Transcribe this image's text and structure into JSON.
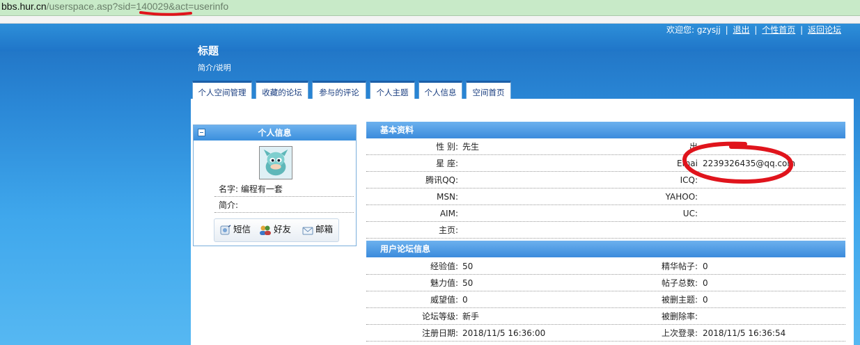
{
  "address_bar": {
    "host": "bbs.hur.cn",
    "path": "/userspace.asp?sid=140029&act=userinfo"
  },
  "top_links": {
    "welcome": "欢迎您: gzysjj",
    "logout": "退出",
    "personal_home": "个性首页",
    "back_forum": "返回论坛",
    "separator": "|"
  },
  "header": {
    "title": "标题",
    "subtitle": "简介/说明"
  },
  "tabs": [
    {
      "label": "个人空间管理"
    },
    {
      "label": "收藏的论坛"
    },
    {
      "label": "参与的评论"
    },
    {
      "label": "个人主题"
    },
    {
      "label": "个人信息"
    },
    {
      "label": "空间首页"
    }
  ],
  "profile_box": {
    "heading": "个人信息",
    "name_label": "名字:",
    "name_value": "编程有一套",
    "intro_label": "简介:",
    "intro_value": "",
    "actions": [
      {
        "label": "短信",
        "icon": "message-icon"
      },
      {
        "label": "好友",
        "icon": "friends-icon"
      },
      {
        "label": "邮箱",
        "icon": "mailbox-icon"
      }
    ]
  },
  "basic_info": {
    "heading": "基本资料",
    "rows": [
      {
        "k1": "性 别:",
        "v1": "先生",
        "k2": "出",
        "v2": ""
      },
      {
        "k1": "星 座:",
        "v1": "",
        "k2": "Emai",
        "v2": "2239326435@qq.com"
      },
      {
        "k1": "腾讯QQ:",
        "v1": "",
        "k2": "ICQ:",
        "v2": ""
      },
      {
        "k1": "MSN:",
        "v1": "",
        "k2": "YAHOO:",
        "v2": ""
      },
      {
        "k1": "AIM:",
        "v1": "",
        "k2": "UC:",
        "v2": ""
      },
      {
        "k1": "主页:",
        "v1": "",
        "k2": "",
        "v2": ""
      }
    ]
  },
  "forum_info": {
    "heading": "用户论坛信息",
    "rows": [
      {
        "k1": "经验值:",
        "v1": "50",
        "k2": "精华帖子:",
        "v2": "0"
      },
      {
        "k1": "魅力值:",
        "v1": "50",
        "k2": "帖子总数:",
        "v2": "0"
      },
      {
        "k1": "威望值:",
        "v1": "0",
        "k2": "被删主题:",
        "v2": "0"
      },
      {
        "k1": "论坛等级:",
        "v1": "新手",
        "k2": "被删除率:",
        "v2": ""
      },
      {
        "k1": "注册日期:",
        "v1": "2018/11/5 16:36:00",
        "k2": "上次登录:",
        "v2": "2018/11/5 16:36:54"
      }
    ]
  },
  "colors": {
    "annotation_red": "#e0141c",
    "tab_border": "#1c5fa8",
    "header_blue": "#3b8bdc"
  }
}
